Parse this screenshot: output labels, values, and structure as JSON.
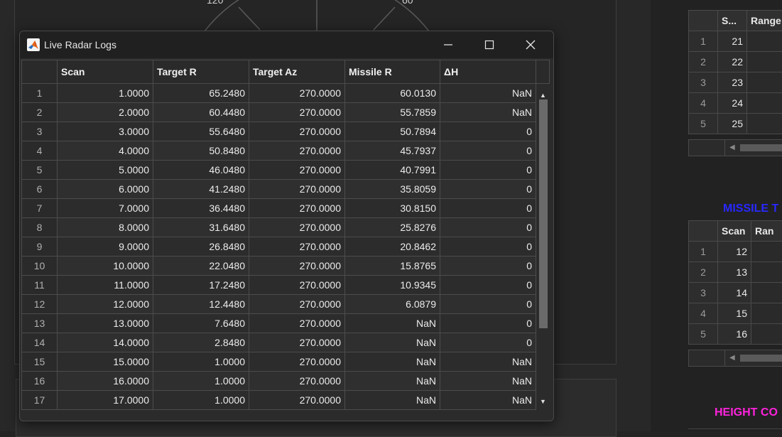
{
  "background": {
    "radar_labels": [
      "120",
      "60"
    ],
    "right_top_table": {
      "headers": [
        "S...",
        "Range"
      ],
      "rows": [
        {
          "n": "1",
          "v": "21"
        },
        {
          "n": "2",
          "v": "22"
        },
        {
          "n": "3",
          "v": "23"
        },
        {
          "n": "4",
          "v": "24"
        },
        {
          "n": "5",
          "v": "25"
        }
      ]
    },
    "missile_label": "MISSILE T",
    "right_mid_table": {
      "headers": [
        "Scan",
        "Ran"
      ],
      "rows": [
        {
          "n": "1",
          "v": "12"
        },
        {
          "n": "2",
          "v": "13"
        },
        {
          "n": "3",
          "v": "14"
        },
        {
          "n": "4",
          "v": "15"
        },
        {
          "n": "5",
          "v": "16"
        }
      ]
    },
    "height_label": "HEIGHT CO",
    "colors": {
      "missile_label": "#2828ff",
      "height_label": "#ff22dd",
      "launch_button": "#1c5a1c",
      "abort_button": "#7a1111"
    }
  },
  "window": {
    "title": "Live Radar Logs",
    "icon": "matlab-icon",
    "controls": [
      "minimize-icon",
      "maximize-icon",
      "close-icon"
    ]
  },
  "table": {
    "columns": [
      "Scan",
      "Target R",
      "Target Az",
      "Missile R",
      "ΔH"
    ],
    "rows": [
      {
        "n": "1",
        "cells": [
          "1.0000",
          "65.2480",
          "270.0000",
          "60.0130",
          "NaN"
        ]
      },
      {
        "n": "2",
        "cells": [
          "2.0000",
          "60.4480",
          "270.0000",
          "55.7859",
          "NaN"
        ]
      },
      {
        "n": "3",
        "cells": [
          "3.0000",
          "55.6480",
          "270.0000",
          "50.7894",
          "0"
        ]
      },
      {
        "n": "4",
        "cells": [
          "4.0000",
          "50.8480",
          "270.0000",
          "45.7937",
          "0"
        ]
      },
      {
        "n": "5",
        "cells": [
          "5.0000",
          "46.0480",
          "270.0000",
          "40.7991",
          "0"
        ]
      },
      {
        "n": "6",
        "cells": [
          "6.0000",
          "41.2480",
          "270.0000",
          "35.8059",
          "0"
        ]
      },
      {
        "n": "7",
        "cells": [
          "7.0000",
          "36.4480",
          "270.0000",
          "30.8150",
          "0"
        ]
      },
      {
        "n": "8",
        "cells": [
          "8.0000",
          "31.6480",
          "270.0000",
          "25.8276",
          "0"
        ]
      },
      {
        "n": "9",
        "cells": [
          "9.0000",
          "26.8480",
          "270.0000",
          "20.8462",
          "0"
        ]
      },
      {
        "n": "10",
        "cells": [
          "10.0000",
          "22.0480",
          "270.0000",
          "15.8765",
          "0"
        ]
      },
      {
        "n": "11",
        "cells": [
          "11.0000",
          "17.2480",
          "270.0000",
          "10.9345",
          "0"
        ]
      },
      {
        "n": "12",
        "cells": [
          "12.0000",
          "12.4480",
          "270.0000",
          "6.0879",
          "0"
        ]
      },
      {
        "n": "13",
        "cells": [
          "13.0000",
          "7.6480",
          "270.0000",
          "NaN",
          "0"
        ]
      },
      {
        "n": "14",
        "cells": [
          "14.0000",
          "2.8480",
          "270.0000",
          "NaN",
          "0"
        ]
      },
      {
        "n": "15",
        "cells": [
          "15.0000",
          "1.0000",
          "270.0000",
          "NaN",
          "NaN"
        ]
      },
      {
        "n": "16",
        "cells": [
          "16.0000",
          "1.0000",
          "270.0000",
          "NaN",
          "NaN"
        ]
      },
      {
        "n": "17",
        "cells": [
          "17.0000",
          "1.0000",
          "270.0000",
          "NaN",
          "NaN"
        ]
      }
    ]
  }
}
